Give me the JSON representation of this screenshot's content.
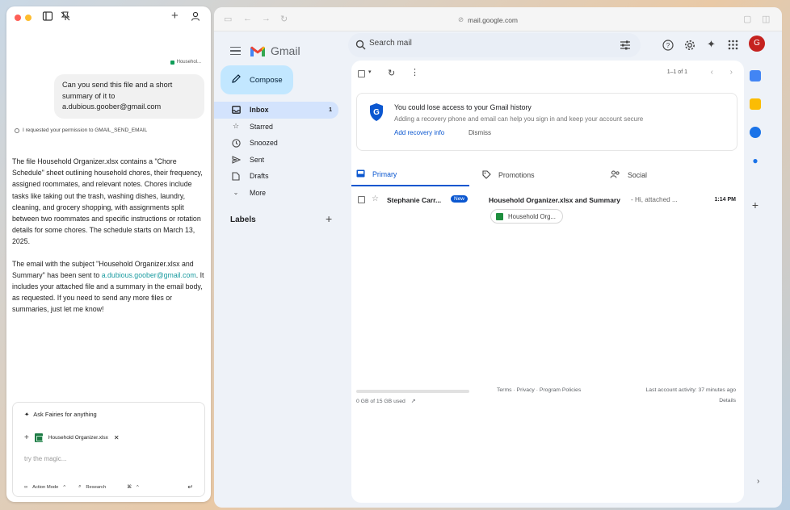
{
  "chat": {
    "user_chip": "Househol...",
    "user_message": "Can you send this file and a short summary of it to a.dubious.goober@gmail.com",
    "permission_note": "I requested your permission to GMAIL_SEND_EMAIL",
    "reply_p1": "The file Household Organizer.xlsx contains a \"Chore Schedule\" sheet outlining household chores, their frequency, assigned roommates, and relevant notes. Chores include tasks like taking out the trash, washing dishes, laundry, cleaning, and grocery shopping, with assignments split between two roommates and specific instructions or rotation details for some chores. The schedule starts on March 13, 2025.",
    "reply_p2_start": "The email with the subject \"Household Organizer.xlsx and Summary\" has been sent to ",
    "reply_p2_link": "a.dubious.goober@gmail.com",
    "reply_p2_end": ". It includes your attached file and a summary in the email body, as requested. If you need to send any more files or summaries, just let me know!",
    "composer": {
      "ask_label": "Ask Fairies for anything",
      "attached_file": "Household Organizer.xlsx",
      "placeholder": "try the magic...",
      "action_mode": "Action Mode",
      "research": "Research"
    }
  },
  "browser": {
    "url": "mail.google.com"
  },
  "gmail": {
    "logo_text": "Gmail",
    "search_placeholder": "Search mail",
    "avatar_letter": "G",
    "compose_label": "Compose",
    "nav": [
      {
        "label": "Inbox",
        "count": "1",
        "icon": "inbox-icon"
      },
      {
        "label": "Starred",
        "count": "",
        "icon": "star-icon"
      },
      {
        "label": "Snoozed",
        "count": "",
        "icon": "clock-icon"
      },
      {
        "label": "Sent",
        "count": "",
        "icon": "send-icon"
      },
      {
        "label": "Drafts",
        "count": "",
        "icon": "draft-icon"
      },
      {
        "label": "More",
        "count": "",
        "icon": "chevron-down-icon"
      }
    ],
    "labels_title": "Labels",
    "pager": "1–1 of 1",
    "banner": {
      "title": "You could lose access to your Gmail history",
      "desc": "Adding a recovery phone and email can help you sign in and keep your account secure",
      "add": "Add recovery info",
      "dismiss": "Dismiss"
    },
    "tabs": [
      {
        "label": "Primary"
      },
      {
        "label": "Promotions"
      },
      {
        "label": "Social"
      }
    ],
    "email": {
      "sender": "Stephanie Carr...",
      "badge": "New",
      "subject": "Household Organizer.xlsx and Summary",
      "snippet": "- Hi, attached ...",
      "time": "1:14 PM",
      "attachment": "Household Org..."
    },
    "footer": {
      "storage": "0 GB of 15 GB used",
      "links": "Terms · Privacy · Program Policies",
      "activity": "Last account activity: 37 minutes ago",
      "details": "Details"
    }
  }
}
